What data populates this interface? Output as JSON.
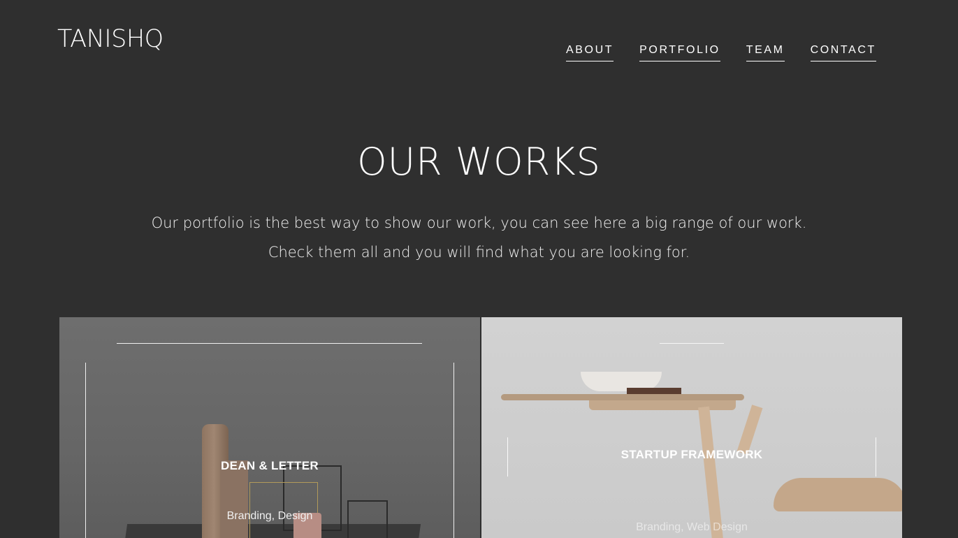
{
  "brand": {
    "logo": "TANISHQ"
  },
  "nav": {
    "items": [
      {
        "label": "ABOUT"
      },
      {
        "label": "PORTFOLIO"
      },
      {
        "label": "TEAM"
      },
      {
        "label": "CONTACT"
      }
    ]
  },
  "hero": {
    "title": "OUR WORKS",
    "line1": "Our portfolio is the best way to show our work, you can see here a big range of our work.",
    "line2": "Check them all and you will find what you are looking for."
  },
  "portfolio": {
    "items": [
      {
        "title": "DEAN & LETTER",
        "categories": "Branding, Design"
      },
      {
        "title": "STARTUP FRAMEWORK",
        "categories": "Branding, Web Design"
      }
    ]
  },
  "colors": {
    "background": "#2f2f2f",
    "text": "#ffffff"
  }
}
